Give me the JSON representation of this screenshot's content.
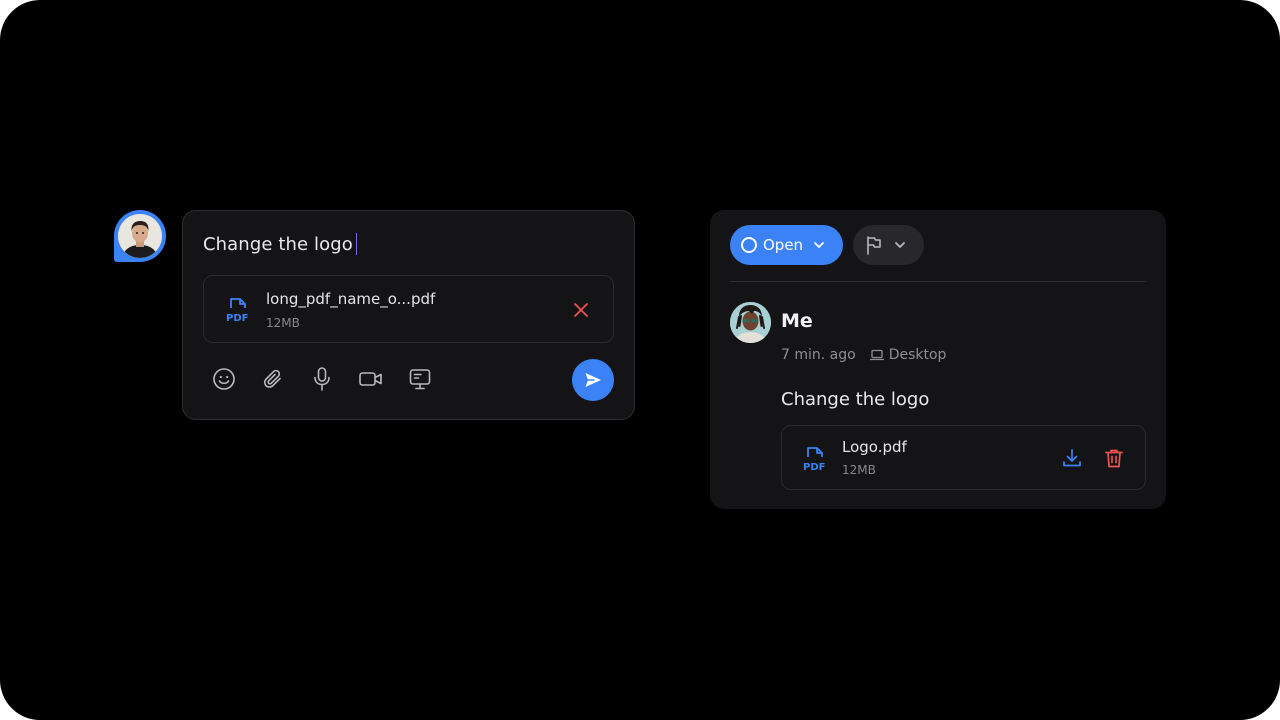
{
  "composer": {
    "text": "Change the logo",
    "attachment": {
      "name": "long_pdf_name_o...pdf",
      "size": "12MB",
      "badge": "PDF"
    },
    "tools": [
      "emoji-icon",
      "paperclip-icon",
      "microphone-icon",
      "video-icon",
      "screen-share-icon"
    ],
    "send_icon": "send-icon"
  },
  "card": {
    "status_label": "Open",
    "author": "Me",
    "time": "7 min. ago",
    "device": "Desktop",
    "message": "Change the logo",
    "file": {
      "name": "Logo.pdf",
      "size": "12MB",
      "badge": "PDF"
    }
  },
  "colors": {
    "accent": "#3b82f6",
    "danger": "#f0524f",
    "panel": "#141416",
    "background": "#000000"
  }
}
